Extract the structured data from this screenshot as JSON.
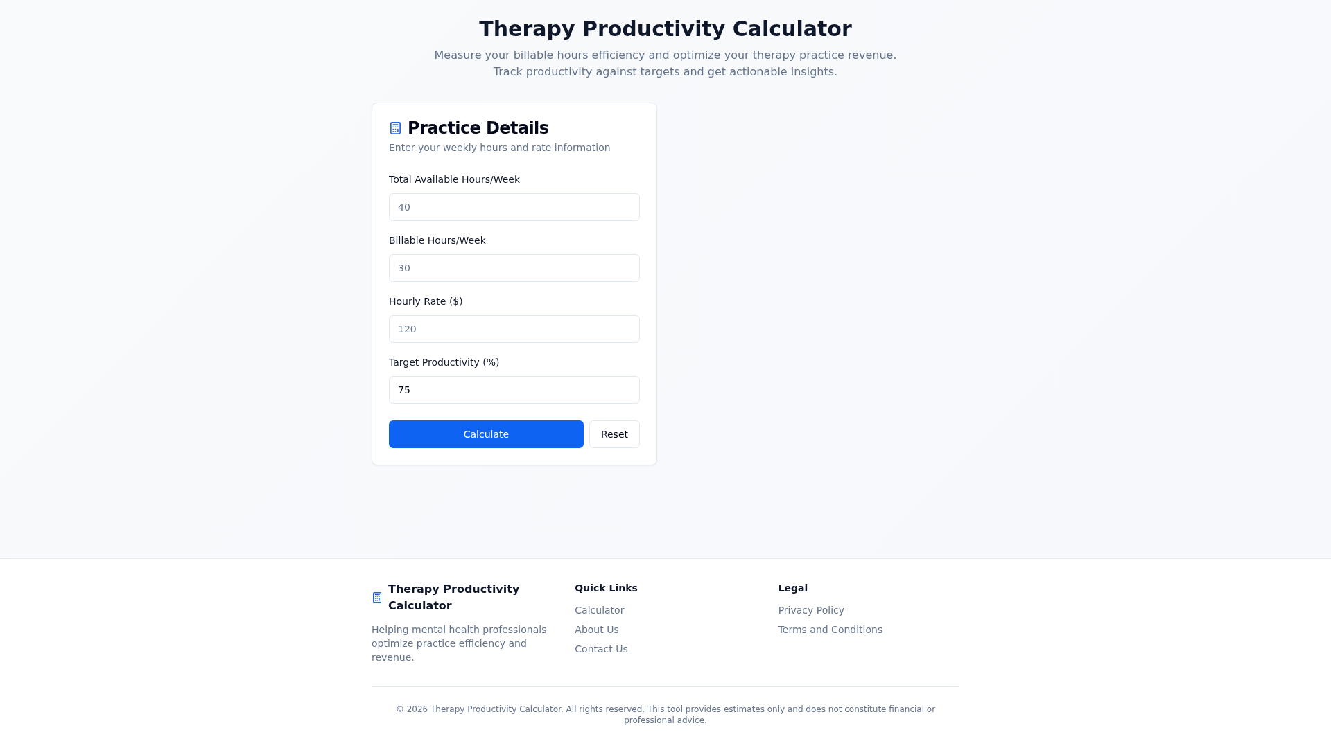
{
  "header": {
    "title": "Therapy Productivity Calculator",
    "subtitle": "Measure your billable hours efficiency and optimize your therapy practice revenue. Track productivity against targets and get actionable insights."
  },
  "practice_details": {
    "title": "Practice Details",
    "description": "Enter your weekly hours and rate information",
    "fields": [
      {
        "label": "Total Available Hours/Week",
        "placeholder": "40"
      },
      {
        "label": "Billable Hours/Week",
        "placeholder": "30"
      },
      {
        "label": "Hourly Rate ($)",
        "placeholder": "120"
      },
      {
        "label": "Target Productivity (%)",
        "value": "75"
      }
    ],
    "buttons": [
      {
        "label": "Calculate",
        "kind": "primary"
      },
      {
        "label": "Reset",
        "kind": "outline"
      }
    ]
  },
  "footer": {
    "brand": {
      "name": "Therapy Productivity Calculator",
      "description": "Helping mental health professionals optimize practice efficiency and revenue."
    },
    "columns": [
      {
        "heading": "Quick Links",
        "links": [
          "Calculator",
          "About Us",
          "Contact Us"
        ]
      },
      {
        "heading": "Legal",
        "links": [
          "Privacy Policy",
          "Terms and Conditions"
        ]
      }
    ],
    "copyright": "© 2026 Therapy Productivity Calculator. All rights reserved. This tool provides estimates only and does not constitute financial or professional advice."
  }
}
